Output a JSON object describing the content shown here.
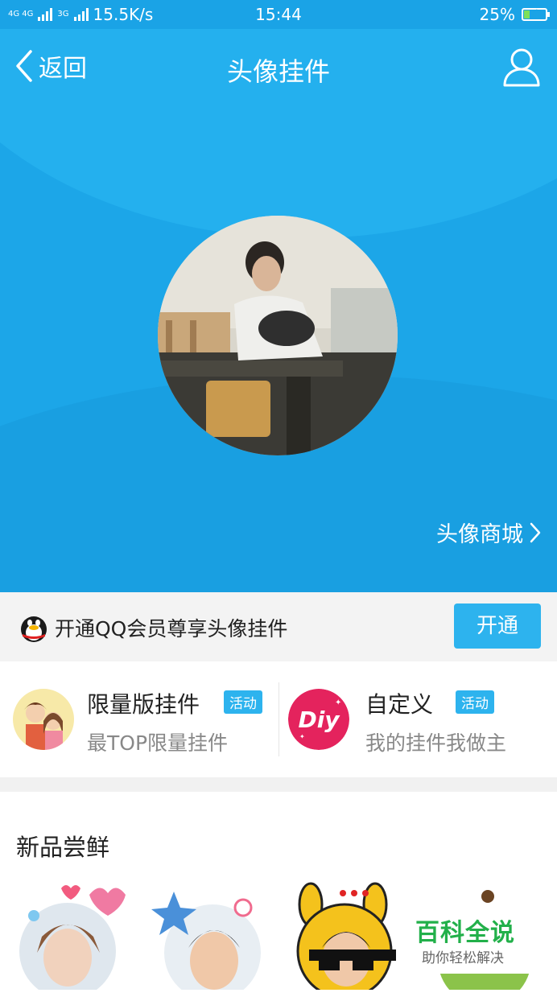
{
  "status_bar": {
    "network_left": "4G 4G",
    "network_right": "3G",
    "speed": "15.5K/s",
    "time": "15:44",
    "battery_percent": "25%",
    "battery_level": 0.25
  },
  "nav": {
    "back_label": "返回",
    "title": "头像挂件"
  },
  "hero": {
    "mall_link": "头像商城"
  },
  "vip": {
    "text": "开通QQ会员尊享头像挂件",
    "button": "开通"
  },
  "cards": [
    {
      "title": "限量版挂件",
      "badge": "活动",
      "subtitle": "最TOP限量挂件"
    },
    {
      "title": "自定义",
      "badge": "活动",
      "subtitle": "我的挂件我做主",
      "icon_text": "Diy"
    }
  ],
  "section": {
    "title": "新品尝鲜"
  },
  "watermark": {
    "main": "百科全说",
    "sub": "助你轻松解决"
  },
  "colors": {
    "accent": "#2db3ee",
    "hero_bg": "#1ca6e8",
    "watermark_green": "#22b04a"
  }
}
